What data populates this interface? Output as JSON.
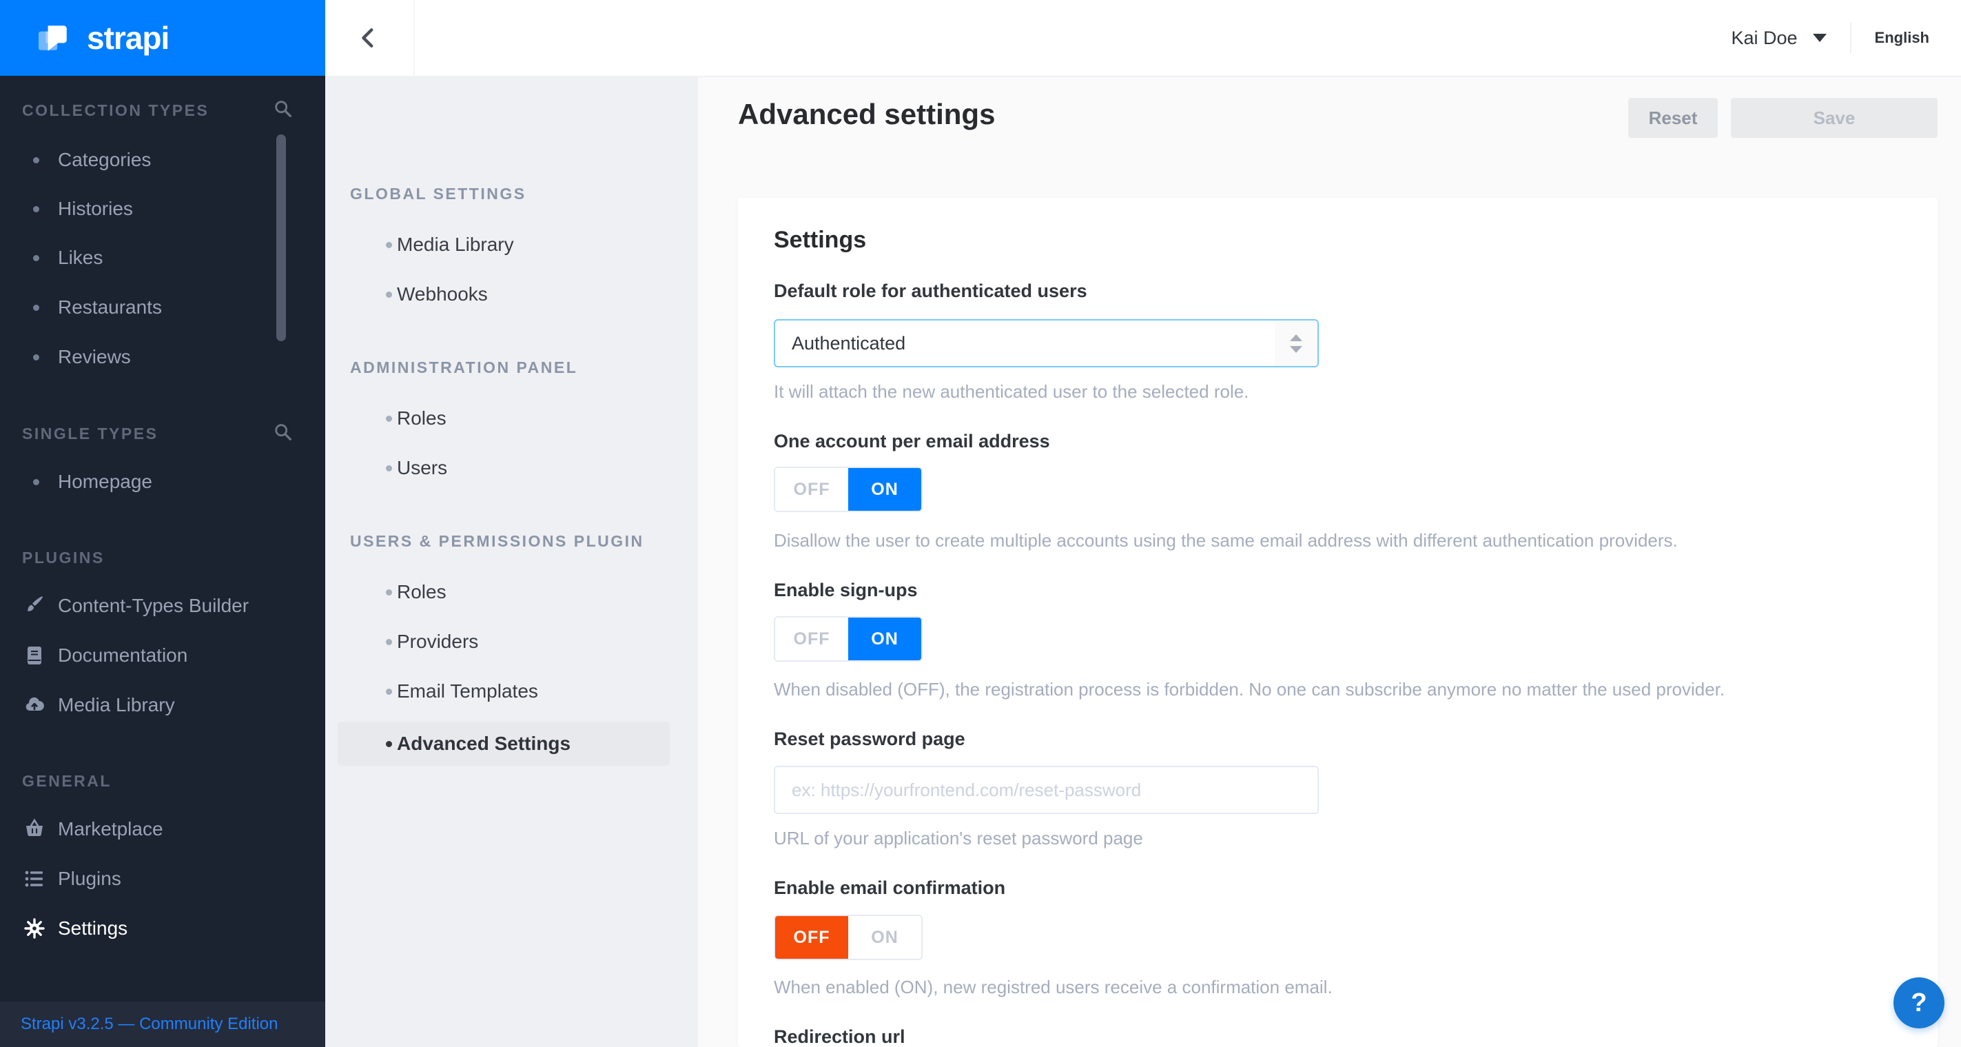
{
  "app": {
    "brand": "strapi",
    "version_footer": "Strapi v3.2.5 — Community Edition"
  },
  "colors": {
    "primary": "#007eff",
    "orange": "#f64d0a",
    "help_button": "#1778d6",
    "select_focus_border": "#7bc9fc",
    "sidebar_dark": "#1b2230"
  },
  "primary_sidebar": {
    "collection_types": {
      "label": "COLLECTION TYPES",
      "items": [
        "Categories",
        "Histories",
        "Likes",
        "Restaurants",
        "Reviews"
      ]
    },
    "single_types": {
      "label": "SINGLE TYPES",
      "items": [
        "Homepage"
      ]
    },
    "plugins": {
      "label": "PLUGINS",
      "items": [
        {
          "icon": "brush-icon",
          "label": "Content-Types Builder"
        },
        {
          "icon": "book-icon",
          "label": "Documentation"
        },
        {
          "icon": "cloud-upload-icon",
          "label": "Media Library"
        }
      ]
    },
    "general": {
      "label": "GENERAL",
      "items": [
        {
          "icon": "basket-icon",
          "label": "Marketplace"
        },
        {
          "icon": "list-icon",
          "label": "Plugins"
        },
        {
          "icon": "gear-icon",
          "label": "Settings",
          "active": true
        }
      ]
    }
  },
  "topbar": {
    "user_name": "Kai Doe",
    "language": "English"
  },
  "settings_nav": {
    "global": {
      "label": "GLOBAL SETTINGS",
      "items": [
        "Media Library",
        "Webhooks"
      ]
    },
    "admin": {
      "label": "ADMINISTRATION PANEL",
      "items": [
        "Roles",
        "Users"
      ]
    },
    "users_permissions": {
      "label": "USERS & PERMISSIONS PLUGIN",
      "items": [
        "Roles",
        "Providers",
        "Email Templates",
        "Advanced Settings"
      ],
      "active_item": "Advanced Settings"
    }
  },
  "page": {
    "title": "Advanced settings",
    "actions": {
      "reset": "Reset",
      "save": "Save"
    },
    "card": {
      "title": "Settings",
      "default_role": {
        "label": "Default role for authenticated users",
        "value": "Authenticated",
        "help": "It will attach the new authenticated user to the selected role."
      },
      "one_account": {
        "label": "One account per email address",
        "off": "OFF",
        "on": "ON",
        "state": "ON",
        "help": "Disallow the user to create multiple accounts using the same email address with different authentication providers."
      },
      "enable_signups": {
        "label": "Enable sign-ups",
        "off": "OFF",
        "on": "ON",
        "state": "ON",
        "help": "When disabled (OFF), the registration process is forbidden. No one can subscribe anymore no matter the used provider."
      },
      "reset_password": {
        "label": "Reset password page",
        "value": "",
        "placeholder": "ex: https://yourfrontend.com/reset-password",
        "help": "URL of your application's reset password page"
      },
      "email_confirmation": {
        "label": "Enable email confirmation",
        "off": "OFF",
        "on": "ON",
        "state": "OFF",
        "help": "When enabled (ON), new registred users receive a confirmation email."
      },
      "redirection_url": {
        "label": "Redirection url"
      }
    }
  },
  "help_button": {
    "label": "?"
  }
}
